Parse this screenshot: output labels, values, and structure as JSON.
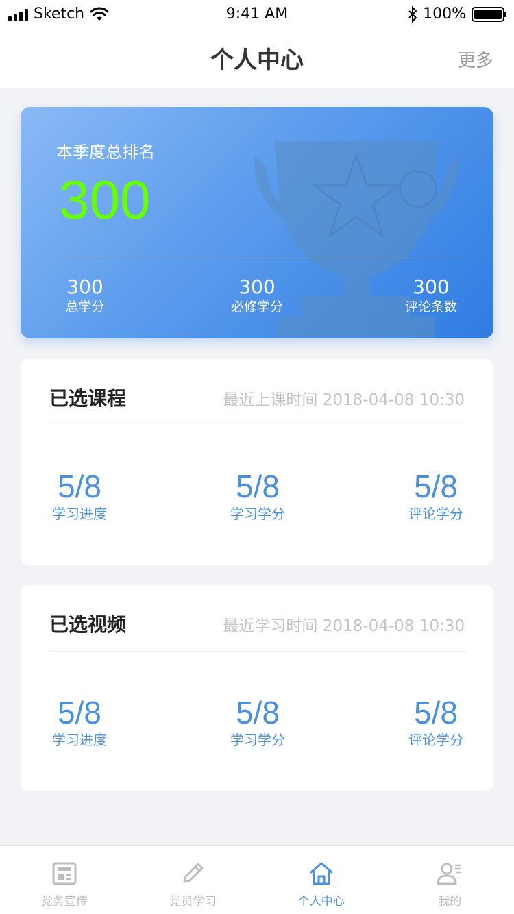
{
  "status_bar": {
    "carrier": "Sketch",
    "time": "9:41 AM",
    "battery": "100%"
  },
  "nav": {
    "title": "个人中心",
    "more": "更多"
  },
  "rank_card": {
    "label": "本季度总排名",
    "value": "300",
    "stats": [
      {
        "value": "300",
        "label": "总学分"
      },
      {
        "value": "300",
        "label": "必修学分"
      },
      {
        "value": "300",
        "label": "评论条数"
      }
    ]
  },
  "courses": {
    "title": "已选课程",
    "time": "最近上课时间 2018-04-08 10:30",
    "metrics": [
      {
        "value": "5/8",
        "label": "学习进度"
      },
      {
        "value": "5/8",
        "label": "学习学分"
      },
      {
        "value": "5/8",
        "label": "评论学分"
      }
    ]
  },
  "videos": {
    "title": "已选视频",
    "time": "最近学习时间 2018-04-08 10:30",
    "metrics": [
      {
        "value": "5/8",
        "label": "学习进度"
      },
      {
        "value": "5/8",
        "label": "学习学分"
      },
      {
        "value": "5/8",
        "label": "评论学分"
      }
    ]
  },
  "tabs": [
    {
      "label": "党务宣传",
      "icon": "newspaper-icon",
      "active": false
    },
    {
      "label": "党员学习",
      "icon": "pencil-icon",
      "active": false
    },
    {
      "label": "个人中心",
      "icon": "home-icon",
      "active": true
    },
    {
      "label": "我的",
      "icon": "user-icon",
      "active": false
    }
  ],
  "colors": {
    "accent": "#4a90e2",
    "rank_value": "#66ff00",
    "tab_inactive": "#bdbdbd"
  }
}
